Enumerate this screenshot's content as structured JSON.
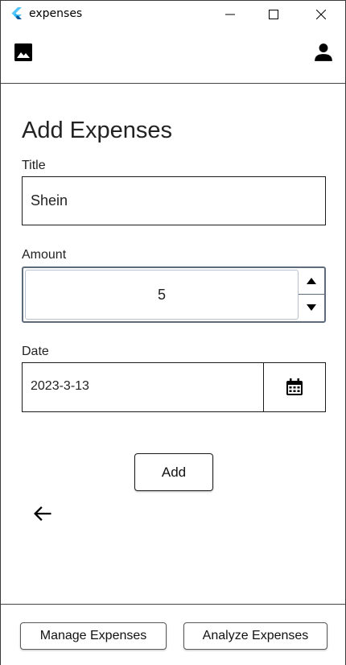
{
  "window": {
    "title": "expenses"
  },
  "appbar": {
    "left_icon": "image-icon",
    "right_icon": "person-icon"
  },
  "form": {
    "heading": "Add Expenses",
    "title_label": "Title",
    "title_value": "Shein",
    "amount_label": "Amount",
    "amount_value": "5",
    "date_label": "Date",
    "date_value": "2023-3-13",
    "add_label": "Add"
  },
  "footer": {
    "manage_label": "Manage Expenses",
    "analyze_label": "Analyze Expenses"
  },
  "colors": {
    "accent_border": "#5e6b7a",
    "text": "#222222",
    "flutter_blue": "#42a5f5"
  }
}
